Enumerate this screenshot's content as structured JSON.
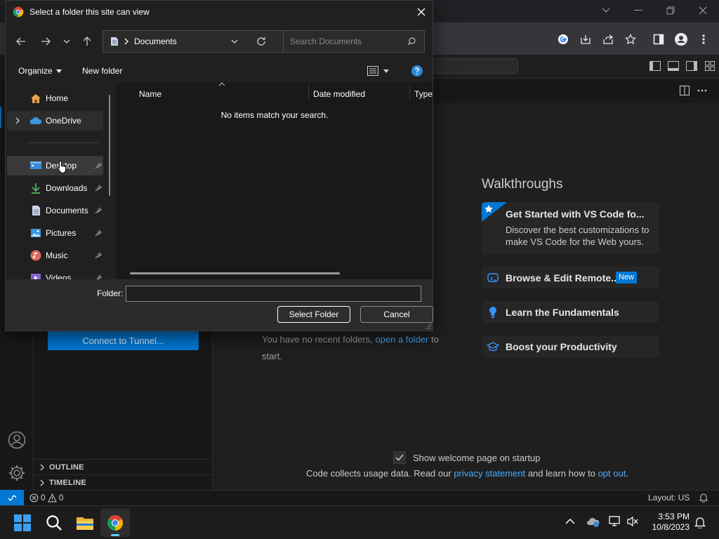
{
  "dialog": {
    "title": "Select a folder this site can view",
    "address": "Documents",
    "search_placeholder": "Search Documents",
    "organize_label": "Organize",
    "new_folder_label": "New folder",
    "nav_items": [
      {
        "label": "Home",
        "icon": "home-icon",
        "pinned": false
      },
      {
        "label": "OneDrive",
        "icon": "cloud-icon",
        "pinned": false
      },
      {
        "label": "Desktop",
        "icon": "desktop-icon",
        "pinned": true
      },
      {
        "label": "Downloads",
        "icon": "download-icon",
        "pinned": true
      },
      {
        "label": "Documents",
        "icon": "documents-icon",
        "pinned": true
      },
      {
        "label": "Pictures",
        "icon": "pictures-icon",
        "pinned": true
      },
      {
        "label": "Music",
        "icon": "music-icon",
        "pinned": true
      },
      {
        "label": "Videos",
        "icon": "videos-icon",
        "pinned": true
      }
    ],
    "columns": {
      "name": "Name",
      "date_modified": "Date modified",
      "type": "Type"
    },
    "empty_message": "No items match your search.",
    "folder_label": "Folder:",
    "folder_value": "",
    "select_button": "Select Folder",
    "cancel_button": "Cancel"
  },
  "vscode": {
    "connect_tunnel": "Connect to Tunnel...",
    "recent_text": "You have no recent folders,",
    "open_folder_link": "open a folder",
    "recent_to": "to",
    "recent_start": "start.",
    "walkthroughs_title": "Walkthroughs",
    "walkthroughs": [
      {
        "title": "Get Started with VS Code fo...",
        "description": "Discover the best customizations to make VS Code for the Web yours.",
        "icon": "star-icon"
      },
      {
        "title": "Browse & Edit Remote...",
        "badge": "New",
        "icon": "remote-icon"
      },
      {
        "title": "Learn the Fundamentals",
        "icon": "lightbulb-icon"
      },
      {
        "title": "Boost your Productivity",
        "icon": "mortarboard-icon"
      }
    ],
    "show_welcome": "Show welcome page on startup",
    "usage_prefix": "Code collects usage data. Read our",
    "privacy_link": "privacy statement",
    "usage_middle": "and learn how to",
    "opt_out_link": "opt out",
    "usage_suffix": ".",
    "outline_label": "OUTLINE",
    "timeline_label": "TIMELINE",
    "status_problems": "0",
    "status_warnings": "0",
    "layout_label": "Layout: US"
  },
  "taskbar": {
    "time": "3:53 PM",
    "date": "10/8/2023"
  },
  "colors": {
    "accent": "#0078d4",
    "link": "#4daafc"
  }
}
